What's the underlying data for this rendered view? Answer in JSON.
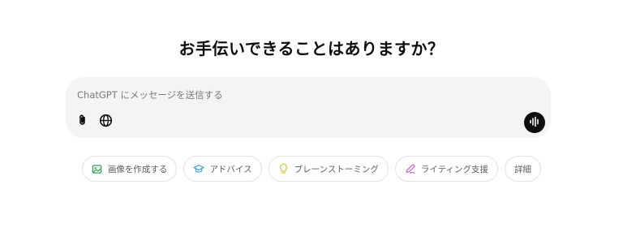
{
  "heading": "お手伝いできることはありますか？",
  "composer": {
    "placeholder": "ChatGPT にメッセージを送信する",
    "attach_icon": "paperclip-icon",
    "globe_icon": "globe-icon",
    "voice_icon": "voice-waveform-icon"
  },
  "suggestions": [
    {
      "label": "画像を作成する",
      "icon": "image-icon",
      "color": "#2fa84f"
    },
    {
      "label": "アドバイス",
      "icon": "graduation-cap-icon",
      "color": "#4aa8e8"
    },
    {
      "label": "ブレーンストーミング",
      "icon": "lightbulb-icon",
      "color": "#e2c541"
    },
    {
      "label": "ライティング支援",
      "icon": "pen-icon",
      "color": "#c86dd7"
    },
    {
      "label": "詳細",
      "icon": "",
      "color": ""
    }
  ]
}
